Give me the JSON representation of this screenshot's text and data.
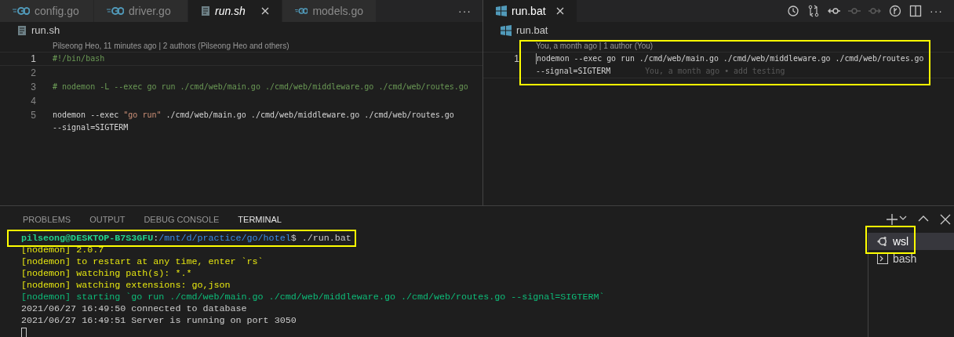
{
  "editor_groups": [
    {
      "tabs": [
        {
          "label": "config.go",
          "kind": "go",
          "selected": false,
          "preview": false
        },
        {
          "label": "driver.go",
          "kind": "go",
          "selected": false,
          "preview": false
        },
        {
          "label": "run.sh",
          "kind": "file",
          "selected": true,
          "preview": true
        },
        {
          "label": "models.go",
          "kind": "go",
          "selected": false,
          "preview": false
        }
      ],
      "more_actions": "···",
      "breadcrumb": {
        "kind": "file",
        "label": "run.sh"
      },
      "codelens": "Pilseong Heo, 11 minutes ago | 2 authors (Pilseong Heo and others)",
      "lines": [
        {
          "number": "1",
          "current": true,
          "rows": [
            [
              {
                "text": "#!/bin/bash",
                "kind": "comment"
              }
            ]
          ]
        },
        {
          "number": "2",
          "current": false,
          "rows": [
            []
          ]
        },
        {
          "number": "3",
          "current": false,
          "rows": [
            [
              {
                "text": "# nodemon -L --exec go run ./cmd/web/main.go ./cmd/web/middleware.go ./cmd/web/routes.go",
                "kind": "comment"
              }
            ]
          ]
        },
        {
          "number": "4",
          "current": false,
          "rows": [
            []
          ]
        },
        {
          "number": "5",
          "current": false,
          "rows": [
            [
              {
                "text": "nodemon --exec ",
                "kind": "plain"
              },
              {
                "text": "\"go run\"",
                "kind": "string"
              },
              {
                "text": " ./cmd/web/main.go ./cmd/web/middleware.go ./cmd/web/routes.go",
                "kind": "plain"
              }
            ],
            [
              {
                "text": "--signal=SIGTERM",
                "kind": "plain"
              }
            ]
          ]
        }
      ]
    },
    {
      "tabs": [
        {
          "label": "run.bat",
          "kind": "windows",
          "selected": true,
          "preview": false
        }
      ],
      "actions": [
        {
          "kind": "history",
          "disabled": false
        },
        {
          "kind": "compare",
          "disabled": false
        },
        {
          "kind": "prev-commit",
          "disabled": false
        },
        {
          "kind": "commit",
          "disabled": true
        },
        {
          "kind": "next-commit",
          "disabled": true
        },
        {
          "kind": "blame",
          "disabled": false
        },
        {
          "kind": "split",
          "disabled": false
        }
      ],
      "more_actions": "···",
      "breadcrumb": {
        "kind": "windows",
        "label": "run.bat"
      },
      "codelens": "You, a month ago | 1 author (You)",
      "highlighted": true,
      "lines": [
        {
          "number": "1",
          "current": true,
          "cursor": true,
          "rows": [
            [
              {
                "text": "nodemon --exec go run ./cmd/web/main.go ./cmd/web/middleware.go ./cmd/web/routes.go",
                "kind": "plain"
              }
            ],
            [
              {
                "text": "--signal=SIGTERM",
                "kind": "plain"
              },
              {
                "text": "You, a month ago • add testing",
                "kind": "blame"
              }
            ]
          ]
        }
      ]
    }
  ],
  "panel": {
    "tabs": [
      {
        "label": "PROBLEMS",
        "selected": false
      },
      {
        "label": "OUTPUT",
        "selected": false
      },
      {
        "label": "DEBUG CONSOLE",
        "selected": false
      },
      {
        "label": "TERMINAL",
        "selected": true
      }
    ],
    "terminal": {
      "lines": [
        {
          "highlighted": true,
          "segments": [
            {
              "text": "pilseong@DESKTOP-B7S3GFU",
              "kind": "user"
            },
            {
              "text": ":",
              "kind": "plain"
            },
            {
              "text": "/mnt/d/practice/go/hotel",
              "kind": "path"
            },
            {
              "text": "$ ./run.bat",
              "kind": "plain"
            }
          ]
        },
        {
          "segments": [
            {
              "text": "[nodemon] 2.0.7",
              "kind": "yellow"
            }
          ]
        },
        {
          "segments": [
            {
              "text": "[nodemon] to restart at any time, enter `rs`",
              "kind": "yellow"
            }
          ]
        },
        {
          "segments": [
            {
              "text": "[nodemon] watching path(s): *.*",
              "kind": "yellow"
            }
          ]
        },
        {
          "segments": [
            {
              "text": "[nodemon] watching extensions: go,json",
              "kind": "yellow"
            }
          ]
        },
        {
          "segments": [
            {
              "text": "[nodemon] starting `go run ./cmd/web/main.go ./cmd/web/middleware.go ./cmd/web/routes.go --signal=SIGTERM`",
              "kind": "green"
            }
          ]
        },
        {
          "segments": [
            {
              "text": "2021/06/27 16:49:50 connected to database",
              "kind": "plain"
            }
          ]
        },
        {
          "segments": [
            {
              "text": "2021/06/27 16:49:51 Server is running on port 3050",
              "kind": "plain"
            }
          ]
        }
      ],
      "cursor": true
    },
    "shells": [
      {
        "label": "wsl",
        "kind": "ubuntu",
        "selected": true,
        "highlighted": true
      },
      {
        "label": "bash",
        "kind": "terminal",
        "selected": false
      }
    ]
  }
}
